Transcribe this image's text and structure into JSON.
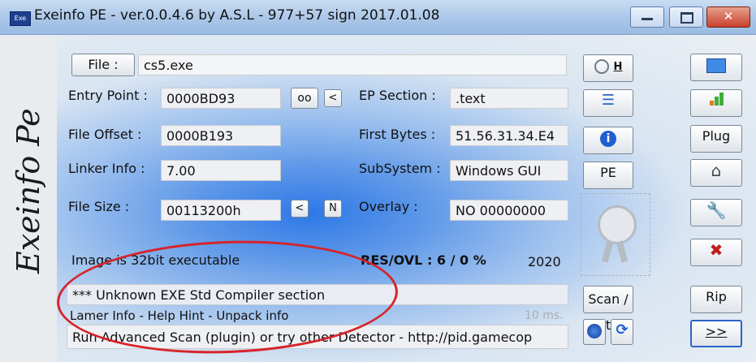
{
  "window": {
    "title": "Exeinfo PE - ver.0.0.4.6  by A.S.L -  977+57 sign  2017.01.08",
    "icon_label": "Exe"
  },
  "sidebar": {
    "text": "Exeinfo Pe"
  },
  "file": {
    "button_label": "File :",
    "value": "cs5.exe"
  },
  "fields": {
    "entry_point": {
      "label": "Entry Point :",
      "value": "0000BD93"
    },
    "file_offset": {
      "label": "File Offset :",
      "value": "0000B193"
    },
    "linker_info": {
      "label": "Linker Info :",
      "value": "7.00"
    },
    "file_size": {
      "label": "File Size :",
      "value": "00113200h"
    },
    "ep_section": {
      "label": "EP Section :",
      "value": ".text"
    },
    "first_bytes": {
      "label": "First Bytes :",
      "value": "51.56.31.34.E4"
    },
    "subsystem": {
      "label": "SubSystem :",
      "value": "Windows GUI"
    },
    "overlay": {
      "label": "Overlay :",
      "value": "NO  00000000"
    }
  },
  "small_buttons": {
    "oo": "oo",
    "less": "<",
    "less2": "<",
    "n": "N"
  },
  "image_info": "Image is 32bit executable",
  "res_ovl": "RES/OVL : 6 / 0 %",
  "year": "2020",
  "detection": "*** Unknown EXE  Std Compiler section",
  "lamer_info": "Lamer Info - Help Hint - Unpack info",
  "time": "10 ms.",
  "scan_hint": "Run Advanced Scan (plugin) or try other Detector - http://pid.gamecop",
  "middle_buttons": {
    "h": "H",
    "pe": "PE",
    "scan": "Scan / t"
  },
  "right_buttons": {
    "plug": "Plug",
    "rip": "Rip",
    "next": ">>"
  },
  "icons": [
    "magnifier-icon",
    "tree-icon",
    "info-icon",
    "seal-icon",
    "globe-icon",
    "refresh-icon",
    "folder-icon",
    "bar-chart-icon",
    "home-icon",
    "wrench-icon",
    "close-x-icon"
  ]
}
